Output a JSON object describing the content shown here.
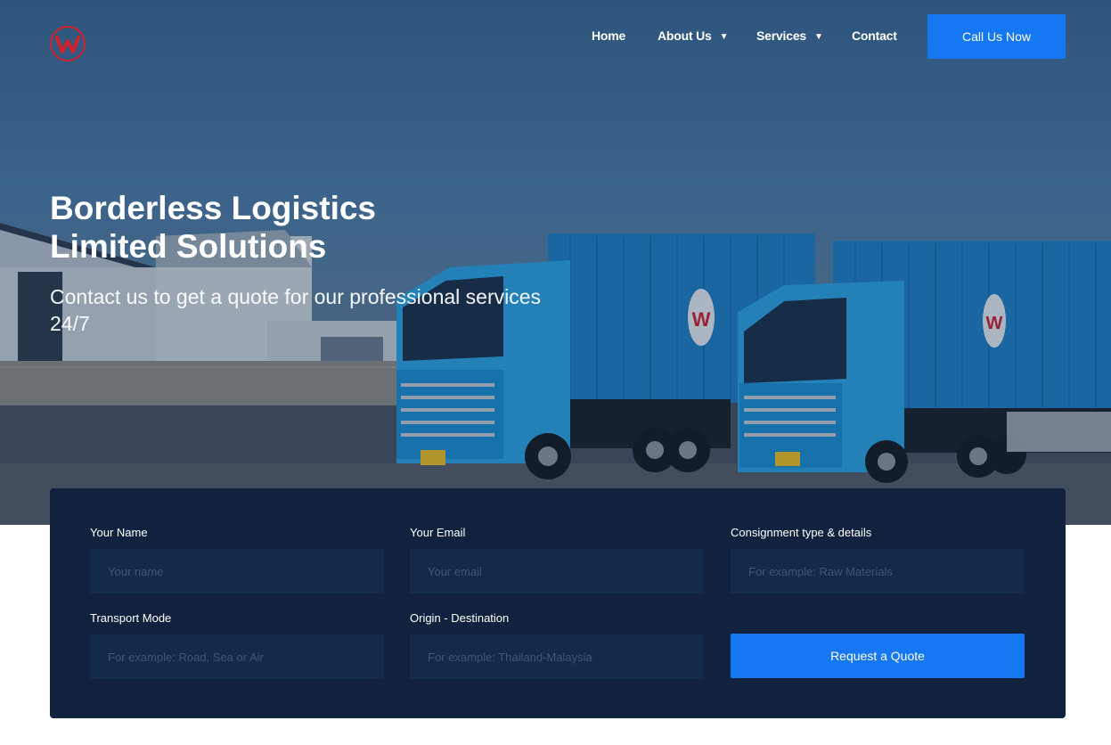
{
  "brand": {
    "logo_letter": "W",
    "logo_color": "#d0202b"
  },
  "nav": {
    "items": [
      {
        "label": "Home",
        "has_dropdown": false
      },
      {
        "label": "About Us",
        "has_dropdown": true
      },
      {
        "label": "Services",
        "has_dropdown": true
      },
      {
        "label": "Contact",
        "has_dropdown": false
      }
    ],
    "caret": "▼",
    "cta_label": "Call Us Now"
  },
  "hero": {
    "title_line1": "Borderless Logistics",
    "title_line2": "Limited Solutions",
    "subtitle": "Contact us to get a quote for our professional services 24/7"
  },
  "form": {
    "name": {
      "label": "Your Name",
      "placeholder": "Your name"
    },
    "email": {
      "label": "Your Email",
      "placeholder": "Your email"
    },
    "consignment": {
      "label": "Consignment type & details",
      "placeholder": "For example: Raw Materials"
    },
    "mode": {
      "label": "Transport Mode",
      "placeholder": "For example: Road, Sea or Air"
    },
    "route": {
      "label": "Origin - Destination",
      "placeholder": "For example: Thailand-Malaysia"
    },
    "submit_label": "Request a Quote"
  },
  "colors": {
    "accent": "#1677f2",
    "panel": "#10223e",
    "input": "#142a4a"
  }
}
